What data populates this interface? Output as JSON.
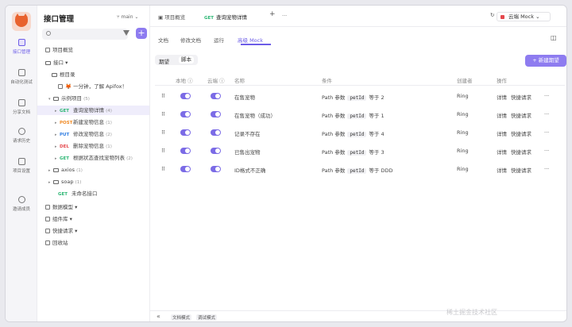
{
  "app": {
    "project_title": "接口管理",
    "branch": "main"
  },
  "rail": [
    {
      "label": "接口管理",
      "active": true
    },
    {
      "label": "自动化测试"
    },
    {
      "label": "分享文档"
    },
    {
      "label": "请求历史"
    },
    {
      "label": "项目设置"
    },
    {
      "label": "邀请成员"
    }
  ],
  "tree": {
    "rows": [
      {
        "text": "项目概览"
      },
      {
        "text": "接口 ▾"
      },
      {
        "text": "根目录"
      },
      {
        "text": "🦊 一分钟，了解 Apifox！"
      },
      {
        "text": "示例项目",
        "count": "(5)"
      },
      {
        "method": "GET",
        "text": "查询宠物详情",
        "count": "(4)",
        "selected": true
      },
      {
        "method": "POST",
        "text": "新建宠物信息",
        "count": "(1)"
      },
      {
        "method": "PUT",
        "text": "修改宠物信息",
        "count": "(2)"
      },
      {
        "method": "DEL",
        "text": "删除宠物信息",
        "count": "(1)"
      },
      {
        "method": "GET",
        "text": "根据状态查找宠物列表",
        "count": "(2)"
      },
      {
        "text": "axios",
        "count": "(1)"
      },
      {
        "text": "soap",
        "count": "(1)"
      },
      {
        "method": "GET",
        "text": "未命名接口"
      },
      {
        "text": "数据模型 ▾"
      },
      {
        "text": "组件库 ▾"
      },
      {
        "text": "快捷请求 ▾"
      },
      {
        "text": "回收站"
      }
    ]
  },
  "tabs": {
    "overview": "项目概览",
    "active_method": "GET",
    "active_label": "查询宠物详情",
    "add": "+",
    "more": "···"
  },
  "env": "云端 Mock",
  "subtabs": [
    "文档",
    "修改文档",
    "运行",
    "高级 Mock"
  ],
  "segment": [
    "期望",
    "脚本"
  ],
  "new_button": "+ 新建期望",
  "table": {
    "headers": [
      "本地",
      "云端",
      "名称",
      "条件",
      "创建者",
      "操作"
    ],
    "rows": [
      {
        "name": "在售宠物",
        "cond_pre": "Path 参数",
        "param": "petId",
        "cond_op": "等于 2",
        "creator": "Ring",
        "act1": "详情",
        "act2": "快捷请求",
        "more": "···"
      },
      {
        "name": "在售宠物（成功）",
        "cond_pre": "Path 参数",
        "param": "petId",
        "cond_op": "等于 1",
        "creator": "Ring",
        "act1": "详情",
        "act2": "快捷请求",
        "more": "···"
      },
      {
        "name": "记录不存在",
        "cond_pre": "Path 参数",
        "param": "petId",
        "cond_op": "等于 4",
        "creator": "Ring",
        "act1": "详情",
        "act2": "快捷请求",
        "more": "···"
      },
      {
        "name": "已售出宠物",
        "cond_pre": "Path 参数",
        "param": "petId",
        "cond_op": "等于 3",
        "creator": "Ring",
        "act1": "详情",
        "act2": "快捷请求",
        "more": "···"
      },
      {
        "name": "ID格式不正确",
        "cond_pre": "Path 参数",
        "param": "petId",
        "cond_op": "等于 DDD",
        "creator": "Ring",
        "act1": "详情",
        "act2": "快捷请求",
        "more": "···"
      }
    ]
  },
  "bottom": {
    "collapse": "«",
    "doc_mode": "文档模式",
    "debug_mode": "调试模式"
  },
  "watermark": "稀土掘金技术社区",
  "colors": {
    "accent": "#6c5ce7",
    "get": "#2bb673",
    "post": "#f08a24",
    "put": "#2f7de1",
    "del": "#e5484d"
  }
}
